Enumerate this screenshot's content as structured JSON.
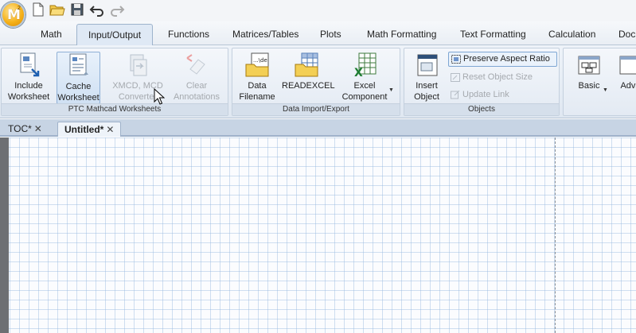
{
  "app": {
    "logo_letter": "M",
    "logo_sup": "2"
  },
  "quick_access": {
    "buttons": [
      "new-document-icon",
      "open-folder-icon",
      "save-icon",
      "undo-icon",
      "redo-icon"
    ]
  },
  "tabs": [
    {
      "label": "Math"
    },
    {
      "label": "Input/Output"
    },
    {
      "label": "Functions"
    },
    {
      "label": "Matrices/Tables"
    },
    {
      "label": "Plots"
    },
    {
      "label": "Math Formatting"
    },
    {
      "label": "Text Formatting"
    },
    {
      "label": "Calculation"
    },
    {
      "label": "Docu"
    }
  ],
  "active_tab": "Input/Output",
  "ribbon": {
    "ptc_group": {
      "label": "PTC Mathcad Worksheets",
      "include": {
        "line1": "Include",
        "line2": "Worksheet"
      },
      "cache": {
        "line1": "Cache",
        "line2": "Worksheet"
      },
      "xmcd": {
        "line1": "XMCD, MCD",
        "line2": "Converter"
      },
      "clear": {
        "line1": "Clear",
        "line2": "Annotations"
      }
    },
    "import_group": {
      "label": "Data Import/Export",
      "data_filename": {
        "line1": "Data",
        "line2": "Filename"
      },
      "readexcel": {
        "line1": "READEXCEL"
      },
      "excel_component": {
        "line1": "Excel",
        "line2": "Component"
      }
    },
    "objects_group": {
      "label": "Objects",
      "insert_object": {
        "line1": "Insert",
        "line2": "Object"
      },
      "preserve_aspect": "Preserve Aspect Ratio",
      "reset_size": "Reset Object Size",
      "update_link": "Update Link"
    },
    "plots_group": {
      "basic": "Basic",
      "advanced": "Adva"
    }
  },
  "doc_tabs": [
    {
      "label": "TOC*",
      "close": "✕"
    },
    {
      "label": "Untitled*",
      "close": "✕"
    }
  ],
  "colors": {
    "accent": "#7ea6d3",
    "grid": "#96b9e1",
    "excel_green": "#1e7d32"
  }
}
